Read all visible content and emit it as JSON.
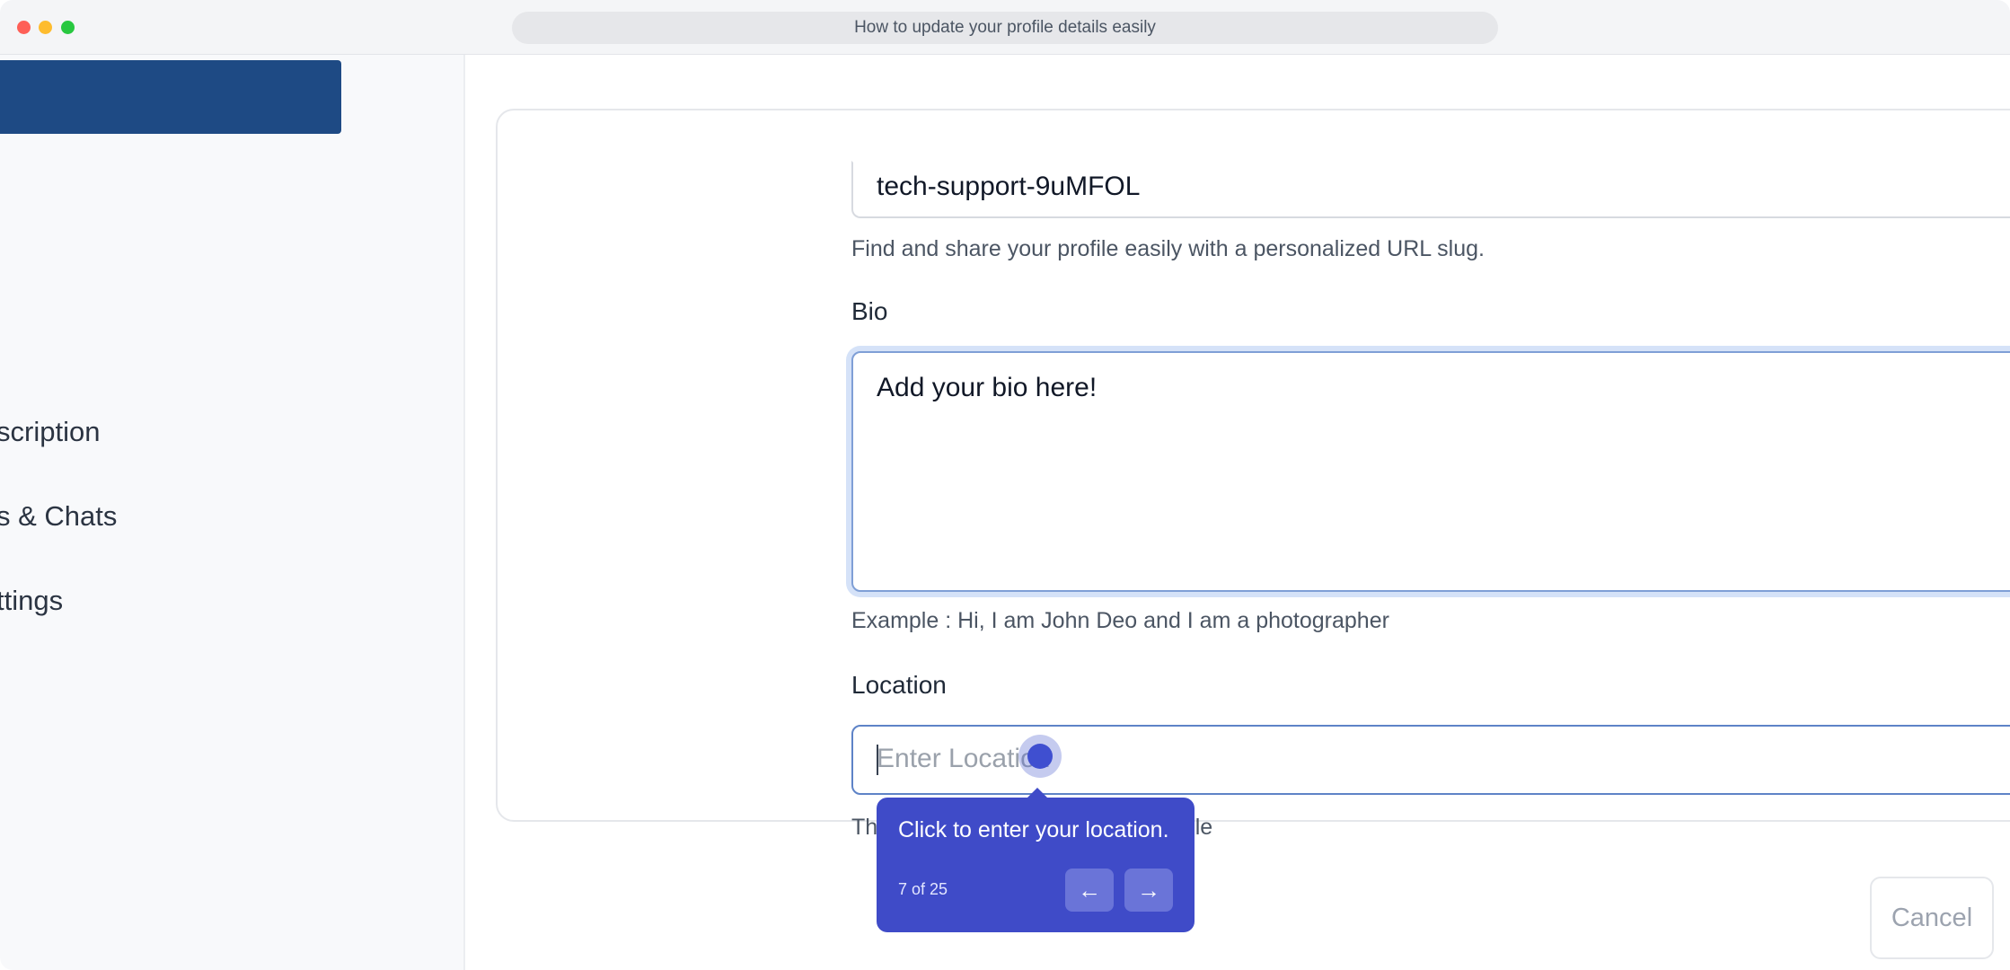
{
  "browser": {
    "title": "How to update your profile details easily"
  },
  "sidebar": {
    "items": [
      {
        "label": "scription"
      },
      {
        "label": "s & Chats"
      },
      {
        "label": "ttings"
      }
    ]
  },
  "form": {
    "slug": {
      "value": "tech-support-9uMFOL",
      "help": "Find and share your profile easily with a personalized URL slug."
    },
    "bio": {
      "label": "Bio",
      "value": "Add your bio here!",
      "help": "Example : Hi, I am John Deo and I am a photographer"
    },
    "location": {
      "label": "Location",
      "placeholder": "Enter Location",
      "help_visible": "Th",
      "help_visible_end": "ile"
    },
    "cancel_label": "Cancel"
  },
  "tour": {
    "message": "Click to enter your location.",
    "step": "7 of 25",
    "prev_icon": "arrow-left-icon",
    "next_icon": "arrow-right-icon",
    "accent": "#3f4bc8"
  }
}
